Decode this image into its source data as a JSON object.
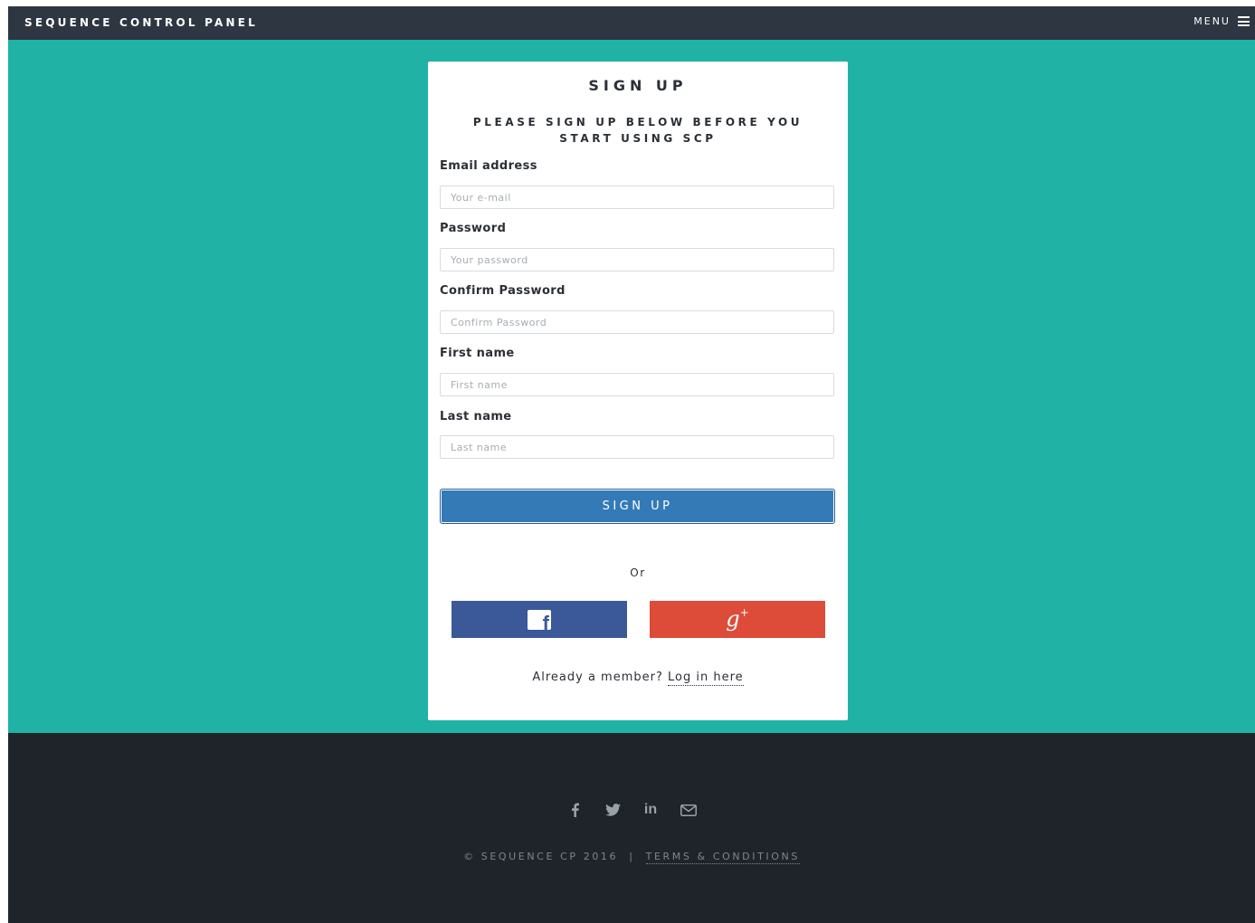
{
  "header": {
    "brand": "SEQUENCE CONTROL PANEL",
    "menu_label": "MENU"
  },
  "card": {
    "title": "SIGN UP",
    "subtitle": "PLEASE SIGN UP BELOW BEFORE YOU START USING SCP",
    "fields": [
      {
        "label": "Email address",
        "placeholder": "Your e-mail",
        "value": ""
      },
      {
        "label": "Password",
        "placeholder": "Your password",
        "value": ""
      },
      {
        "label": "Confirm Password",
        "placeholder": "Confirm Password",
        "value": ""
      },
      {
        "label": "First name",
        "placeholder": "First name",
        "value": ""
      },
      {
        "label": "Last name",
        "placeholder": "Last name",
        "value": ""
      }
    ],
    "submit_label": "SIGN UP",
    "or_text": "Or",
    "facebook_icon": "facebook-icon",
    "google_plus_icon": "google-plus-icon",
    "member_text": "Already a member?",
    "login_link": "Log in here"
  },
  "footer": {
    "icons": [
      "facebook-icon",
      "twitter-icon",
      "linkedin-icon",
      "envelope-icon"
    ],
    "copyright": "© SEQUENCE CP 2016",
    "separator": "|",
    "terms_link": "TERMS & CONDITIONS"
  },
  "colors": {
    "topbar": "#2e3641",
    "hero": "#20b2a5",
    "primary_button": "#347ab7",
    "facebook": "#3b5998",
    "google_plus": "#dd4b39",
    "footer": "#1f242a"
  }
}
